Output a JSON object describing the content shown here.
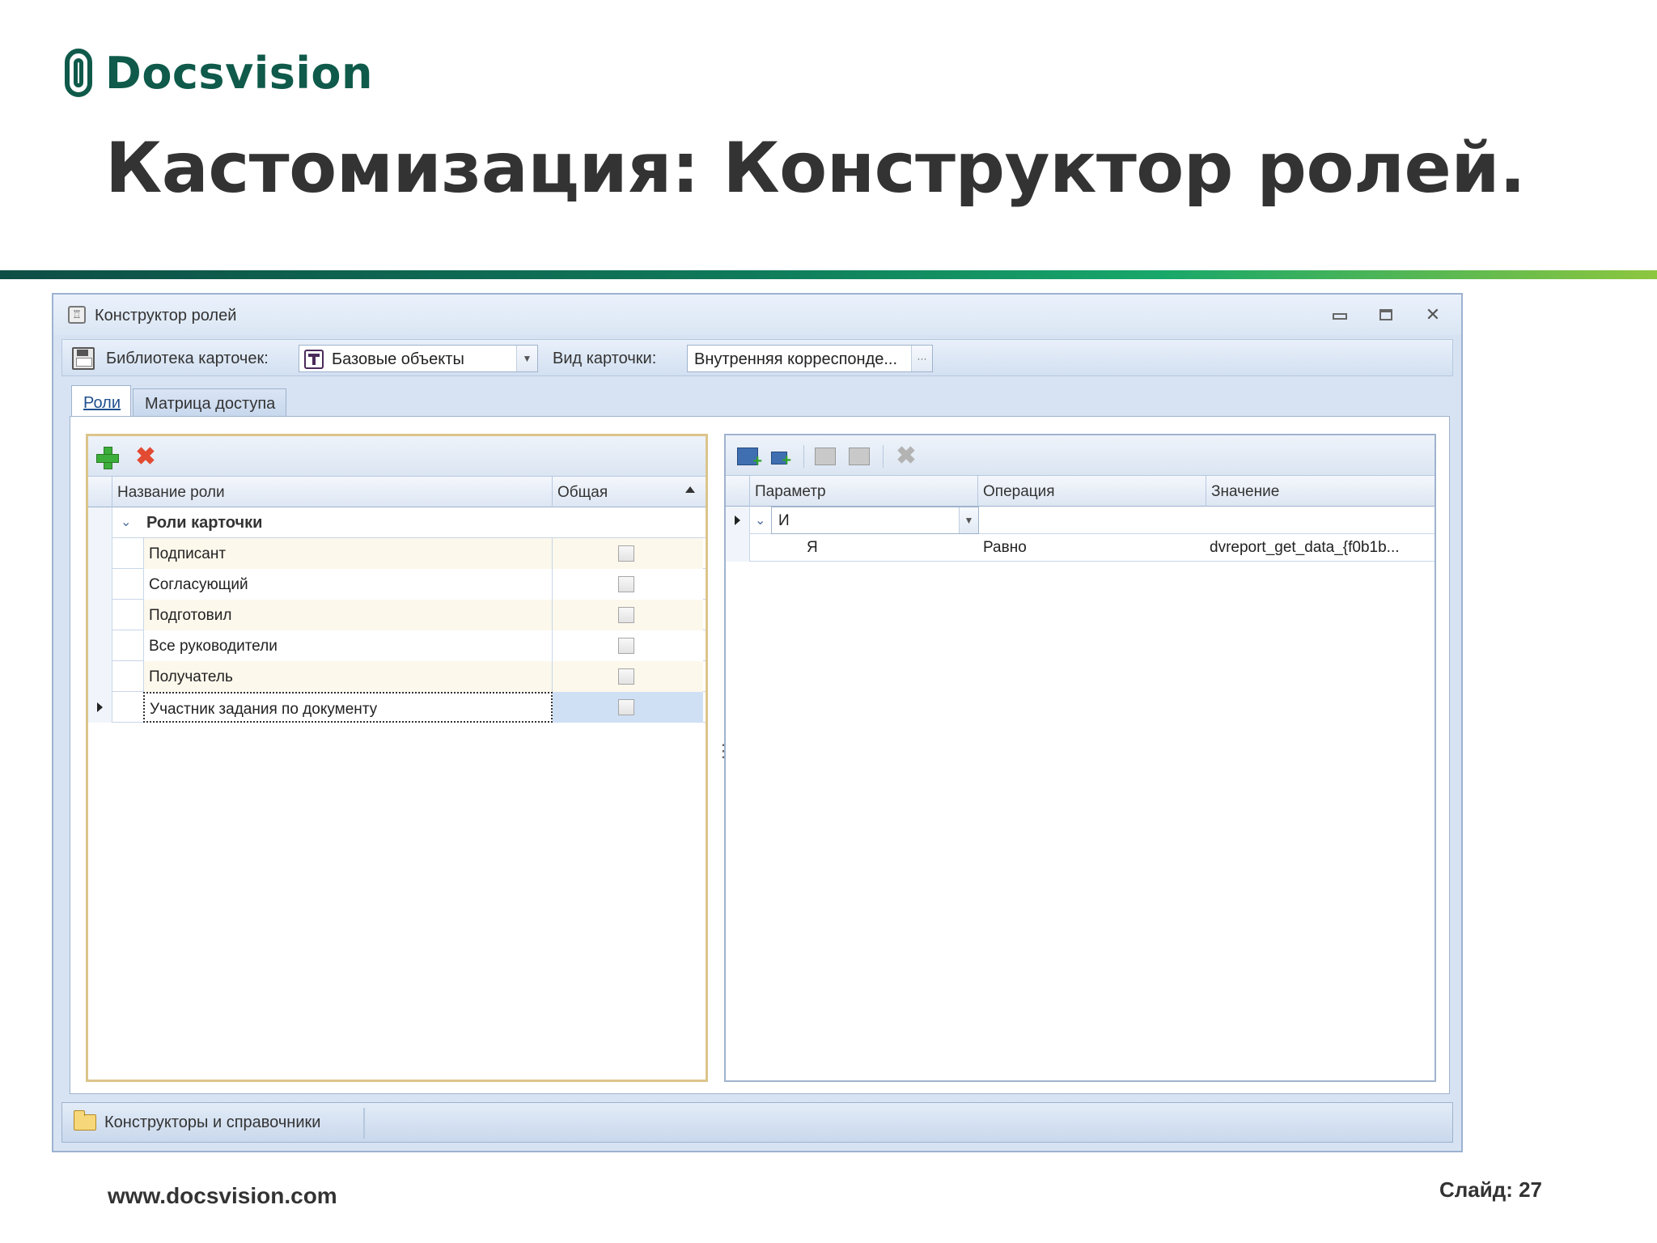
{
  "slide": {
    "logo_text": "Docsvision",
    "title": "Кастомизация: Конструктор ролей.",
    "footer_url": "www.docsvision.com",
    "slide_number": "Слайд: 27",
    "brand_colors": {
      "primary": "#0f5a4a",
      "accent": "#8dc63f"
    }
  },
  "window": {
    "title": "Конструктор ролей",
    "toolbar": {
      "library_label": "Библиотека карточек:",
      "library_value": "Базовые объекты",
      "card_type_label": "Вид карточки:",
      "card_type_value": "Внутренняя корреспонде...",
      "ellipsis": "···"
    },
    "tabs": [
      {
        "label": "Роли",
        "active": true
      },
      {
        "label": "Матрица доступа",
        "active": false
      }
    ],
    "roles_grid": {
      "columns": [
        "Название роли",
        "Общая"
      ],
      "group": "Роли карточки",
      "rows": [
        {
          "name": "Подписант",
          "common": false
        },
        {
          "name": "Согласующий",
          "common": false
        },
        {
          "name": "Подготовил",
          "common": false
        },
        {
          "name": "Все руководители",
          "common": false
        },
        {
          "name": "Получатель",
          "common": false
        },
        {
          "name": "Участник задания по документу",
          "common": false,
          "selected": true
        }
      ]
    },
    "conditions_grid": {
      "columns": [
        "Параметр",
        "Операция",
        "Значение"
      ],
      "group_operator": "И",
      "rows": [
        {
          "parameter": "Я",
          "operation": "Равно",
          "value": "dvreport_get_data_{f0b1b..."
        }
      ]
    },
    "status_bar": {
      "text": "Конструкторы и справочники"
    }
  }
}
